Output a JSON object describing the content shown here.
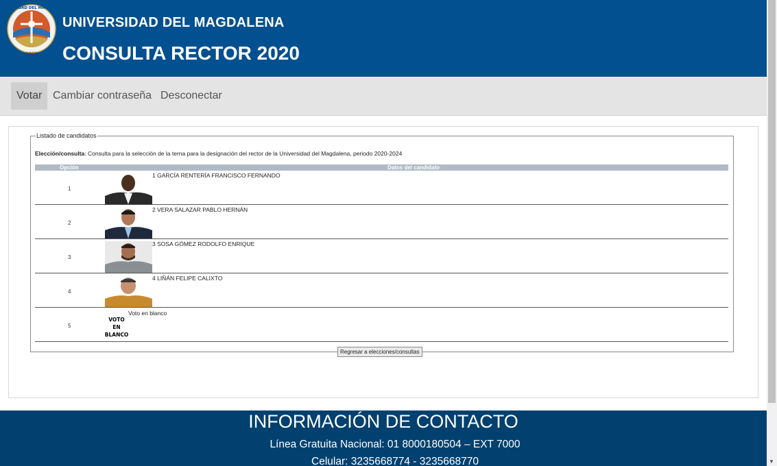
{
  "header": {
    "university": "UNIVERSIDAD DEL MAGDALENA",
    "title": "CONSULTA RECTOR 2020",
    "logo_text": "UNIVERSIDAD DEL MAGDALENA",
    "logo_year": "1962",
    "colors": {
      "bar": "#02508f"
    }
  },
  "nav": {
    "items": [
      {
        "label": "Votar",
        "active": true
      },
      {
        "label": "Cambiar contraseña"
      },
      {
        "label": "Desconectar"
      }
    ]
  },
  "panel": {
    "legend": "Listado de candidatos",
    "consulta_label": "Elección/consulta",
    "consulta_text": ": Consulta para la selección de la terna para la designación del rector de la Universidad del Magdalena, periodo 2020-2024",
    "col_option": "Opción",
    "col_data": "Datos del candidato",
    "candidates": [
      {
        "option": "1",
        "name": "1 GARCÍA RENTERÍA FRANCISCO FERNANDO"
      },
      {
        "option": "2",
        "name": "2 VERA SALAZAR PABLO HERNÁN"
      },
      {
        "option": "3",
        "name": "3 SOSA GÓMEZ RODOLFO ENRIQUE"
      },
      {
        "option": "4",
        "name": "4 LIÑÁN FELIPE CALIXTO"
      }
    ],
    "blank": {
      "option": "5",
      "label": "Voto en blanco",
      "img_line1": "VOTO",
      "img_line2": "EN",
      "img_line3": "BLANCO"
    },
    "back_button": "Regresar a elecciones/consultas"
  },
  "footer": {
    "heading": "INFORMACIÓN DE CONTACTO",
    "line1": "Línea Gratuita Nacional: 01 8000180504 – EXT 7000",
    "line2": "Celular: 3235668774 - 3235668770",
    "color": "#02416f"
  }
}
